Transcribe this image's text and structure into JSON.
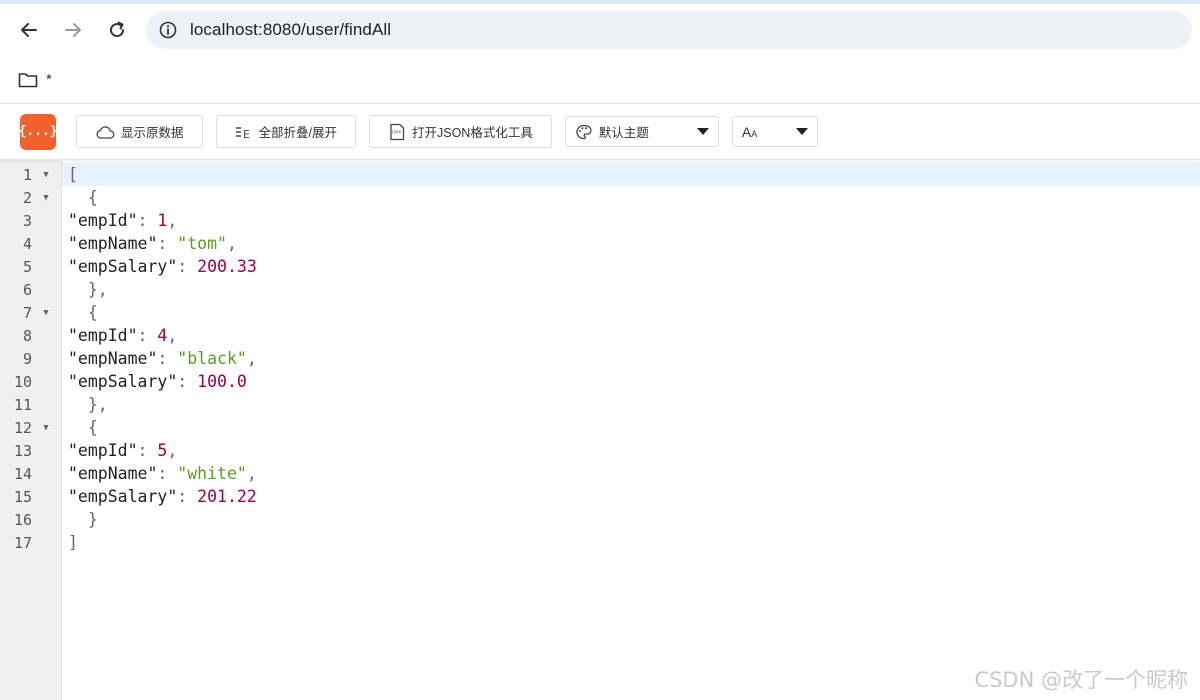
{
  "browser": {
    "url": "localhost:8080/user/findAll",
    "bookmark_label": "*"
  },
  "toolbar": {
    "logo_text": "{...}",
    "show_raw_label": "显示原数据",
    "fold_all_label": "全部折叠/展开",
    "open_tool_label": "打开JSON格式化工具",
    "theme_value": "默认主题",
    "font_value": "A"
  },
  "colors": {
    "logo": "#f0612e",
    "number": "#99004d",
    "string": "#5a9e1c",
    "active_line": "#e8f2ff"
  },
  "code": {
    "line_numbers": [
      "1",
      "2",
      "3",
      "4",
      "5",
      "6",
      "7",
      "8",
      "9",
      "10",
      "11",
      "12",
      "13",
      "14",
      "15",
      "16",
      "17"
    ],
    "foldable_lines": [
      1,
      2,
      7,
      12
    ],
    "employees": [
      {
        "empId": "1",
        "empName": "\"tom\"",
        "empSalary": "200.33"
      },
      {
        "empId": "4",
        "empName": "\"black\"",
        "empSalary": "100.0"
      },
      {
        "empId": "5",
        "empName": "\"white\"",
        "empSalary": "201.22"
      }
    ],
    "keys": {
      "id": "\"empId\"",
      "name": "\"empName\"",
      "salary": "\"empSalary\""
    }
  },
  "watermark": "CSDN @改了一个昵称"
}
